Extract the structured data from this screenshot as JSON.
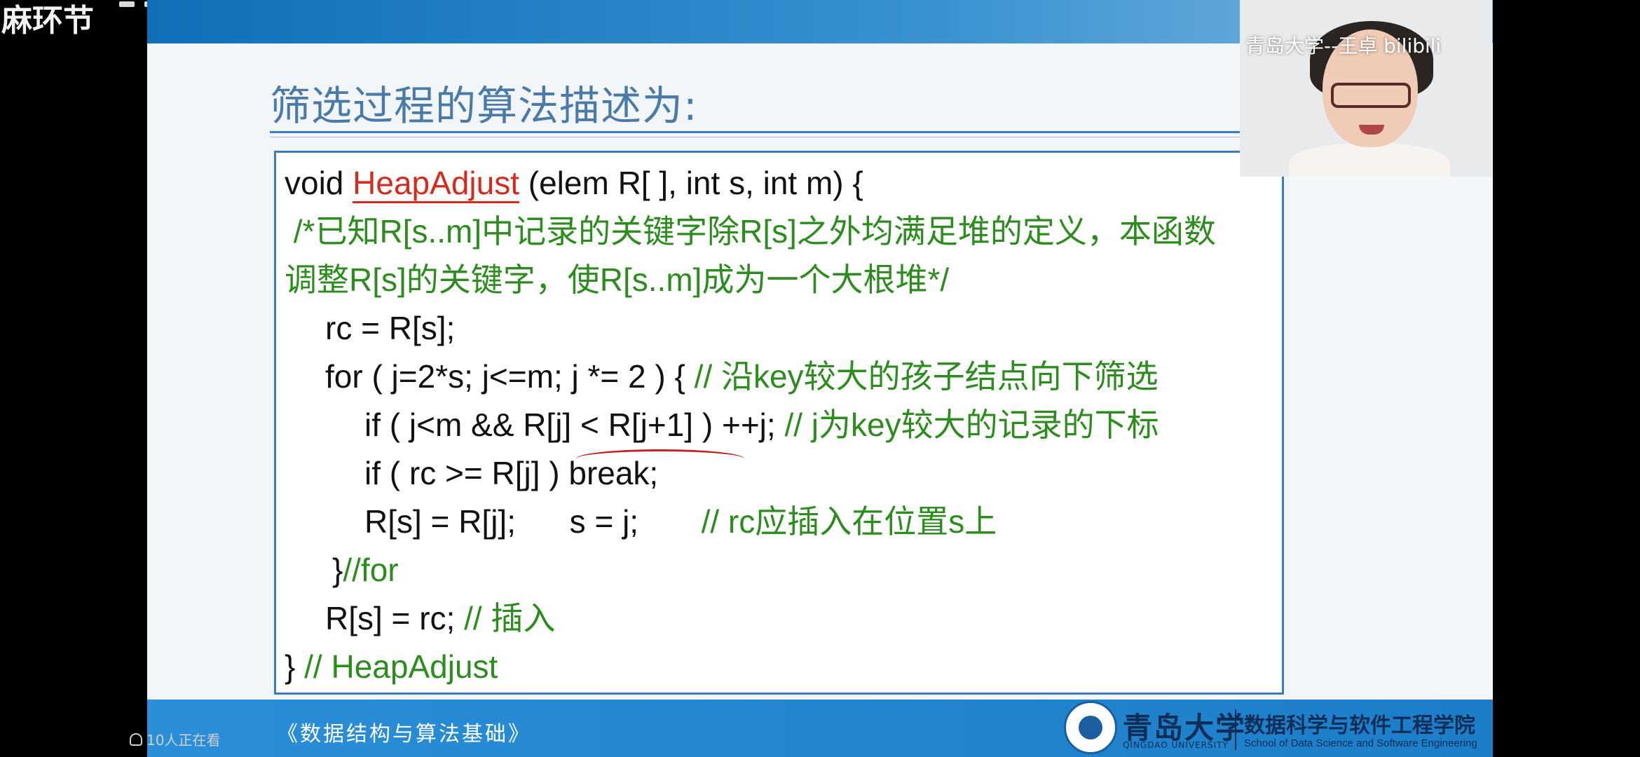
{
  "overlay": {
    "topleft_text": "麻环节",
    "viewer_count": "10人正在看"
  },
  "webcam": {
    "label": "青岛大学--王卓  bilibili"
  },
  "slide": {
    "title": "筛选过程的算法描述为:",
    "course_name": "《数据结构与算法基础》",
    "university_name": "青岛大学",
    "university_en": "QINGDAO UNIVERSITY",
    "department_cn": "数据科学与软件工程学院",
    "department_en": "School of Data Science and Software Engineering",
    "code": {
      "l1_a": "void ",
      "l1_fn": "HeapAdjust",
      "l1_b": " (elem R[ ], int s, int m) {",
      "l2": " /*已知R[s..m]中记录的关键字除R[s]之外均满足堆的定义，本函数",
      "l3": "调整R[s]的关键字，使R[s..m]成为一个大根堆*/",
      "l4": "rc = R[s];",
      "l5_code": "for ( j=2*s; j<=m; j *= 2 ) { ",
      "l5_cmt": "// 沿key较大的孩子结点向下筛选",
      "l6_code": "if ( j<m && R[j] < R[j+1] ) ++j; ",
      "l6_cmt": "// j为key较大的记录的下标",
      "l7": "if ( rc >= R[j] ) break;",
      "l8_code": "R[s] = R[j];      s = j;       ",
      "l8_cmt": "// rc应插入在位置s上",
      "l9_a": "}",
      "l9_cmt": "//for",
      "l10_code": "R[s] = rc; ",
      "l10_cmt": "// 插入",
      "l11_a": "} ",
      "l11_cmt": "// HeapAdjust"
    }
  }
}
